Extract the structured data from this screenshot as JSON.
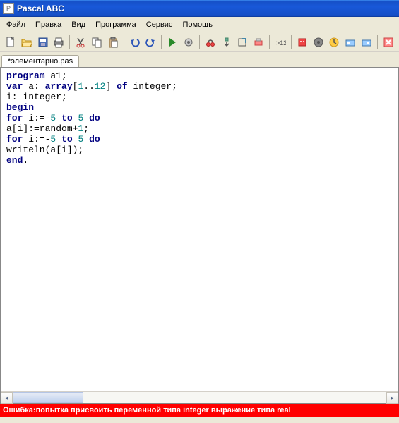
{
  "window": {
    "title": "Pascal ABC"
  },
  "menu": {
    "items": [
      "Файл",
      "Правка",
      "Вид",
      "Программа",
      "Сервис",
      "Помощь"
    ]
  },
  "toolbar": {
    "icons": [
      "new-file-icon",
      "open-file-icon",
      "save-icon",
      "print-icon",
      "sep",
      "cut-icon",
      "copy-icon",
      "paste-icon",
      "sep",
      "undo-icon",
      "redo-icon",
      "sep",
      "run-icon",
      "debug-icon",
      "sep",
      "step-over-icon",
      "step-into-icon",
      "step-out-icon",
      "breakpoint-icon",
      "sep",
      "format-icon",
      "sep",
      "robot-icon",
      "drawman-icon",
      "step-icon",
      "options-icon",
      "help-icon",
      "sep",
      "exit-icon"
    ]
  },
  "tabs": [
    {
      "label": "*элементарно.pas"
    }
  ],
  "code": {
    "lines": [
      [
        {
          "t": "program",
          "c": "kw"
        },
        {
          "t": " a1;",
          "c": ""
        }
      ],
      [
        {
          "t": "var",
          "c": "kw"
        },
        {
          "t": " a: ",
          "c": ""
        },
        {
          "t": "array",
          "c": "kw"
        },
        {
          "t": "[",
          "c": ""
        },
        {
          "t": "1",
          "c": "num"
        },
        {
          "t": "..",
          "c": ""
        },
        {
          "t": "12",
          "c": "num"
        },
        {
          "t": "] ",
          "c": ""
        },
        {
          "t": "of",
          "c": "kw"
        },
        {
          "t": " integer;",
          "c": ""
        }
      ],
      [
        {
          "t": "i: integer;",
          "c": ""
        }
      ],
      [
        {
          "t": "begin",
          "c": "kw"
        }
      ],
      [
        {
          "t": "for",
          "c": "kw"
        },
        {
          "t": " i:=-",
          "c": ""
        },
        {
          "t": "5",
          "c": "num"
        },
        {
          "t": " ",
          "c": ""
        },
        {
          "t": "to",
          "c": "kw"
        },
        {
          "t": " ",
          "c": ""
        },
        {
          "t": "5",
          "c": "num"
        },
        {
          "t": " ",
          "c": ""
        },
        {
          "t": "do",
          "c": "kw"
        }
      ],
      [
        {
          "t": "a[i]:=random+",
          "c": ""
        },
        {
          "t": "1",
          "c": "num"
        },
        {
          "t": ";",
          "c": ""
        }
      ],
      [
        {
          "t": "for",
          "c": "kw"
        },
        {
          "t": " i:=-",
          "c": ""
        },
        {
          "t": "5",
          "c": "num"
        },
        {
          "t": " ",
          "c": ""
        },
        {
          "t": "to",
          "c": "kw"
        },
        {
          "t": " ",
          "c": ""
        },
        {
          "t": "5",
          "c": "num"
        },
        {
          "t": " ",
          "c": ""
        },
        {
          "t": "do",
          "c": "kw"
        }
      ],
      [
        {
          "t": "writeln(a[i]);",
          "c": ""
        }
      ],
      [
        {
          "t": "end",
          "c": "kw"
        },
        {
          "t": ".",
          "c": ""
        }
      ]
    ]
  },
  "statusbar": {
    "prefix": "Ошибка:",
    "message": " попытка присвоить переменной типа integer выражение типа real"
  }
}
